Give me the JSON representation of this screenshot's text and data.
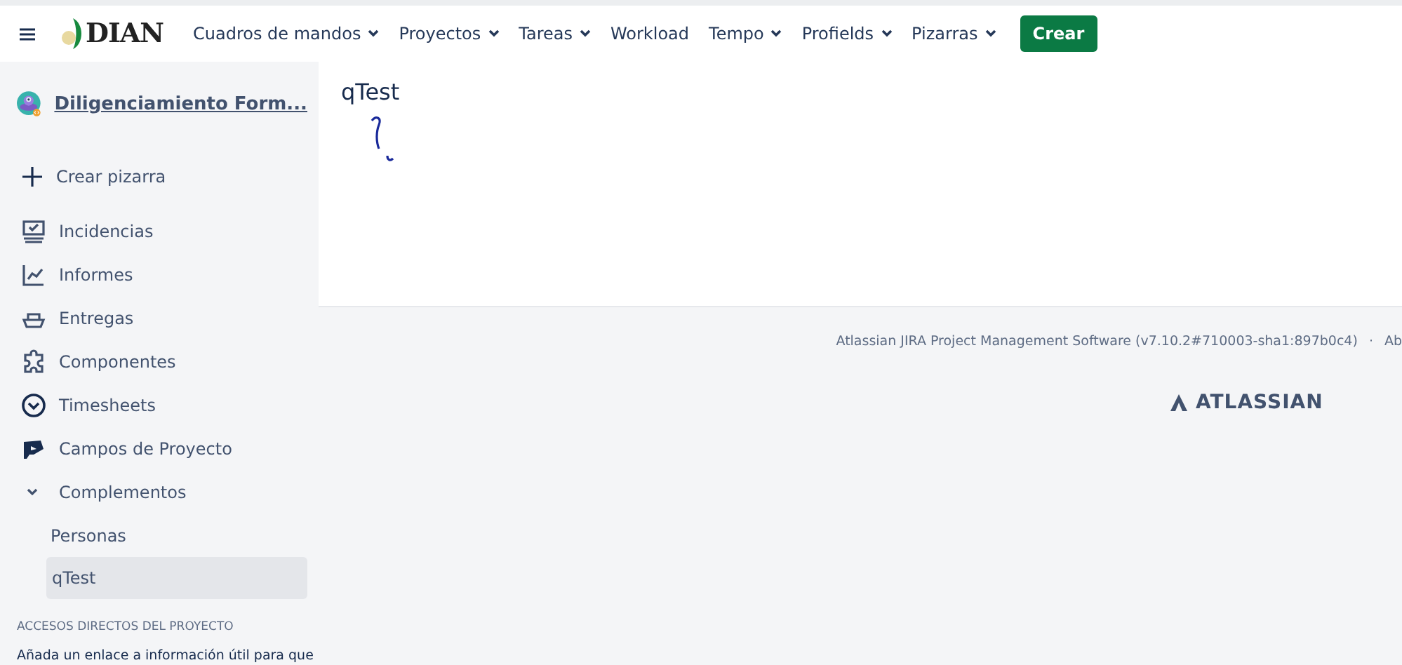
{
  "topbar": {
    "logo": "DIAN",
    "menu": [
      {
        "label": "Cuadros de mandos",
        "dropdown": true
      },
      {
        "label": "Proyectos",
        "dropdown": true
      },
      {
        "label": "Tareas",
        "dropdown": true
      },
      {
        "label": "Workload",
        "dropdown": false
      },
      {
        "label": "Tempo",
        "dropdown": true
      },
      {
        "label": "Profields",
        "dropdown": true
      },
      {
        "label": "Pizarras",
        "dropdown": true
      }
    ],
    "create_button": "Crear"
  },
  "sidebar": {
    "project_name": "Diligenciamiento Form...",
    "create_board": "Crear pizarra",
    "items": [
      {
        "label": "Incidencias",
        "kind": "issues"
      },
      {
        "label": "Informes",
        "kind": "reports"
      },
      {
        "label": "Entregas",
        "kind": "releases"
      },
      {
        "label": "Componentes",
        "kind": "components"
      },
      {
        "label": "Timesheets",
        "kind": "timesheets"
      },
      {
        "label": "Campos de Proyecto",
        "kind": "fields"
      }
    ],
    "addons": {
      "label": "Complementos",
      "expanded": true,
      "children": [
        {
          "label": "Personas",
          "selected": false
        },
        {
          "label": "qTest",
          "selected": true
        }
      ]
    },
    "shortcuts_heading": "ACCESOS DIRECTOS DEL PROYECTO",
    "shortcuts_text": "Añada un enlace a información útil para que"
  },
  "main": {
    "title": "qTest"
  },
  "footer": {
    "version": "Atlassian JIRA Project Management Software (v7.10.2#710003-sha1:897b0c4)",
    "separator": "·",
    "next_link": "Ab",
    "brand": "ATLASSIAN"
  }
}
